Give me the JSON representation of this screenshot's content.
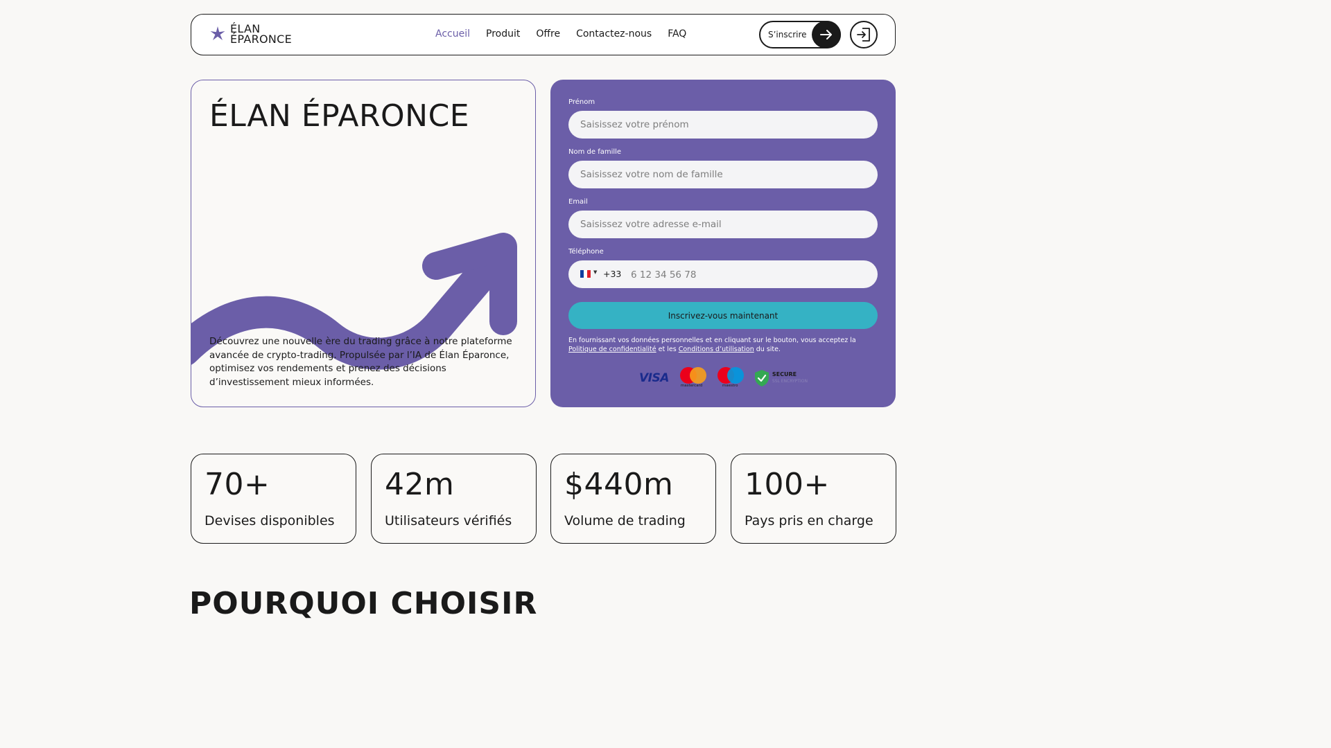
{
  "brand": {
    "logo_line1": "ÉLAN",
    "logo_line2": "ÉPARONCE",
    "accent": "#6b5ea8",
    "cta_color": "#35b2c4"
  },
  "nav": {
    "items": [
      "Accueil",
      "Produit",
      "Offre",
      "Contactez-nous",
      "FAQ"
    ],
    "active": "Accueil"
  },
  "header": {
    "signup_label": "S’inscrire",
    "signup_icon": "arrow-right-icon",
    "login_icon": "login-icon"
  },
  "hero": {
    "title": "ÉLAN ÉPARONCE",
    "description": "Découvrez une nouvelle ère du trading grâce à notre plateforme avancée de crypto-trading. Propulsée par l’IA de Élan Éparonce, optimisez vos rendements et prenez des décisions d’investissement mieux informées."
  },
  "form": {
    "first_name_label": "Prénom",
    "first_name_placeholder": "Saisissez votre prénom",
    "last_name_label": "Nom de famille",
    "last_name_placeholder": "Saisissez votre nom de famille",
    "email_label": "Email",
    "email_placeholder": "Saisissez votre adresse e-mail",
    "phone_label": "Téléphone",
    "phone_dial": "+33",
    "phone_placeholder": "6 12 34 56 78",
    "submit_label": "Inscrivez-vous maintenant",
    "legal_prefix": "En fournissant vos données personnelles et en cliquant sur le bouton, vous acceptez la",
    "privacy_link": "Politique de confidentialité",
    "legal_middle": "et les",
    "terms_link": "Conditions d’utilisation",
    "legal_suffix": "du site.",
    "badges": {
      "visa": "VISA",
      "mastercard": "mastercard",
      "maestro": "maestro",
      "secure": "SECURE",
      "secure_sub": "SSL ENCRYPTION"
    }
  },
  "stats": [
    {
      "value": "70+",
      "label": "Devises disponibles"
    },
    {
      "value": "42m",
      "label": "Utilisateurs vérifiés"
    },
    {
      "value": "$440m",
      "label": "Volume de trading"
    },
    {
      "value": "100+",
      "label": "Pays pris en charge"
    }
  ],
  "why_heading": "POURQUOI CHOISIR"
}
